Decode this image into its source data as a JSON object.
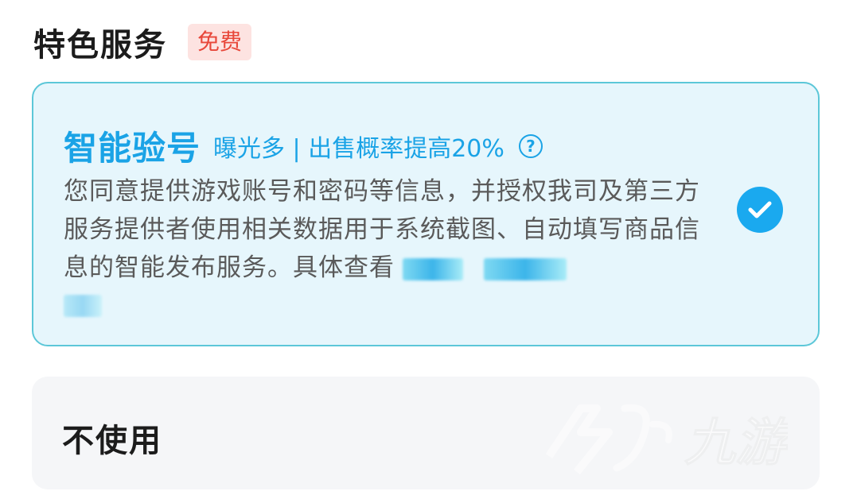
{
  "header": {
    "title": "特色服务",
    "badge": "免费"
  },
  "smart_check": {
    "title": "智能验号",
    "tagline": "曝光多 | 出售概率提高20%",
    "help_icon": "question-circle-icon",
    "description": "您同意提供游戏账号和密码等信息，并授权我司及第三方服务提供者使用相关数据用于系统截图、自动填写商品信息的智能发布服务。具体查看",
    "selected": true,
    "check_icon": "check-circle-icon"
  },
  "no_service": {
    "label": "不使用"
  },
  "colors": {
    "accent": "#1aa3e6",
    "badge_bg": "#fde3e1",
    "badge_text": "#e8473a",
    "card_border": "#5cc7d8",
    "card_bg": "#e6f6fc",
    "unselected_bg": "#f5f6f8"
  },
  "watermark": {
    "text": "九游"
  }
}
